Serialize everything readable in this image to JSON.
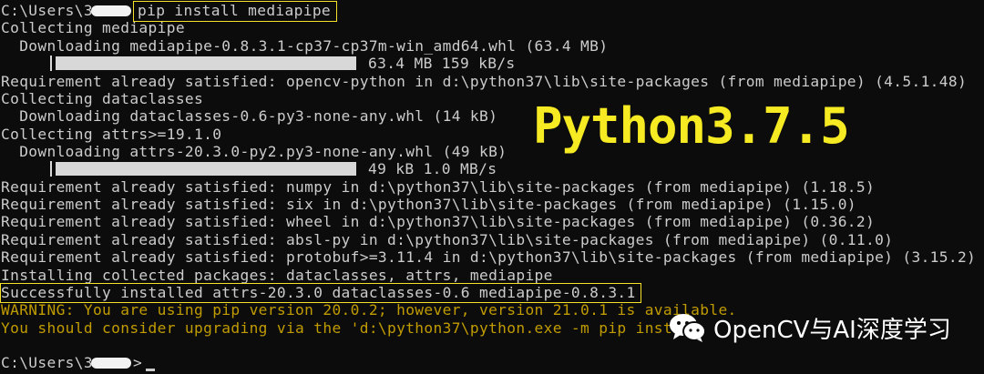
{
  "terminal": {
    "prompt_text": "C:\\Users\\3",
    "command": "pip install mediapipe",
    "lines": [
      "Collecting mediapipe",
      "  Downloading mediapipe-0.8.3.1-cp37-cp37m-win_amd64.whl (63.4 MB)",
      "63.4 MB 159 kB/s",
      "Requirement already satisfied: opencv-python in d:\\python37\\lib\\site-packages (from mediapipe) (4.5.1.48)",
      "Collecting dataclasses",
      "  Downloading dataclasses-0.6-py3-none-any.whl (14 kB)",
      "Collecting attrs>=19.1.0",
      "  Downloading attrs-20.3.0-py2.py3-none-any.whl (49 kB)",
      "49 kB 1.0 MB/s",
      "Requirement already satisfied: numpy in d:\\python37\\lib\\site-packages (from mediapipe) (1.18.5)",
      "Requirement already satisfied: six in d:\\python37\\lib\\site-packages (from mediapipe) (1.15.0)",
      "Requirement already satisfied: wheel in d:\\python37\\lib\\site-packages (from mediapipe) (0.36.2)",
      "Requirement already satisfied: absl-py in d:\\python37\\lib\\site-packages (from mediapipe) (0.11.0)",
      "Requirement already satisfied: protobuf>=3.11.4 in d:\\python37\\lib\\site-packages (from mediapipe) (3.15.2)",
      "Installing collected packages: dataclasses, attrs, mediapipe",
      "Successfully installed attrs-20.3.0 dataclasses-0.6 mediapipe-0.8.3.1",
      "WARNING: You are using pip version 20.0.2; however, version 21.0.1 is available.",
      "You should consider upgrading via the 'd:\\python37\\python.exe -m pip inst",
      "C:\\Users\\3"
    ],
    "progress": [
      1.0,
      1.0
    ]
  },
  "overlay": {
    "title": "Python3.7.5",
    "watermark": "OpenCV与AI深度学习"
  },
  "colors": {
    "background": "#0c0c0c",
    "text": "#cccccc",
    "warning": "#c19c00",
    "highlight": "#f5e12a",
    "title": "#f6ea22"
  }
}
